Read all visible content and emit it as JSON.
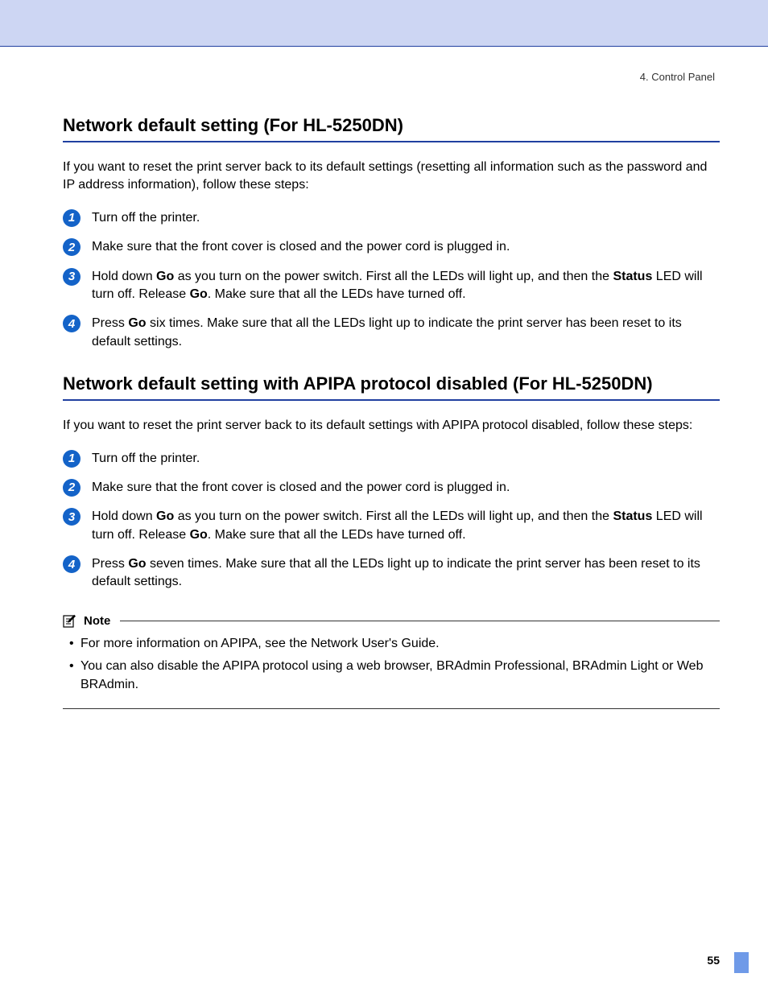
{
  "chapter_ref": "4. Control Panel",
  "section1": {
    "heading": "Network default setting (For HL-5250DN)",
    "intro": "If you want to reset the print server back to its default settings (resetting all information such as the password and IP address information), follow these steps:",
    "steps": [
      {
        "n": "1",
        "html": "Turn off the printer."
      },
      {
        "n": "2",
        "html": "Make sure that the front cover is closed and the power cord is plugged in."
      },
      {
        "n": "3",
        "html": "Hold down <b>Go</b> as you turn on the power switch. First all the LEDs will light up, and then the <b>Status</b> LED will turn off. Release <b>Go</b>. Make sure that all the LEDs have turned off."
      },
      {
        "n": "4",
        "html": "Press <b>Go</b> six times. Make sure that all the LEDs light up to indicate the print server has been reset to its default settings."
      }
    ]
  },
  "section2": {
    "heading": "Network default setting with APIPA protocol disabled (For HL-5250DN)",
    "intro": "If you want to reset the print server back to its default settings with APIPA protocol disabled, follow these steps:",
    "steps": [
      {
        "n": "1",
        "html": "Turn off the printer."
      },
      {
        "n": "2",
        "html": "Make sure that the front cover is closed and the power cord is plugged in."
      },
      {
        "n": "3",
        "html": "Hold down <b>Go</b> as you turn on the power switch. First all the LEDs will light up, and then the <b>Status</b> LED will turn off. Release <b>Go</b>. Make sure that all the LEDs have turned off."
      },
      {
        "n": "4",
        "html": "Press <b>Go</b> seven times. Make sure that all the LEDs light up to indicate the print server has been reset to its default settings."
      }
    ]
  },
  "note": {
    "label": "Note",
    "items": [
      "For more information on APIPA, see the Network User's Guide.",
      "You can also disable the APIPA protocol using a web browser, BRAdmin Professional, BRAdmin Light or Web BRAdmin."
    ]
  },
  "page_number": "55"
}
